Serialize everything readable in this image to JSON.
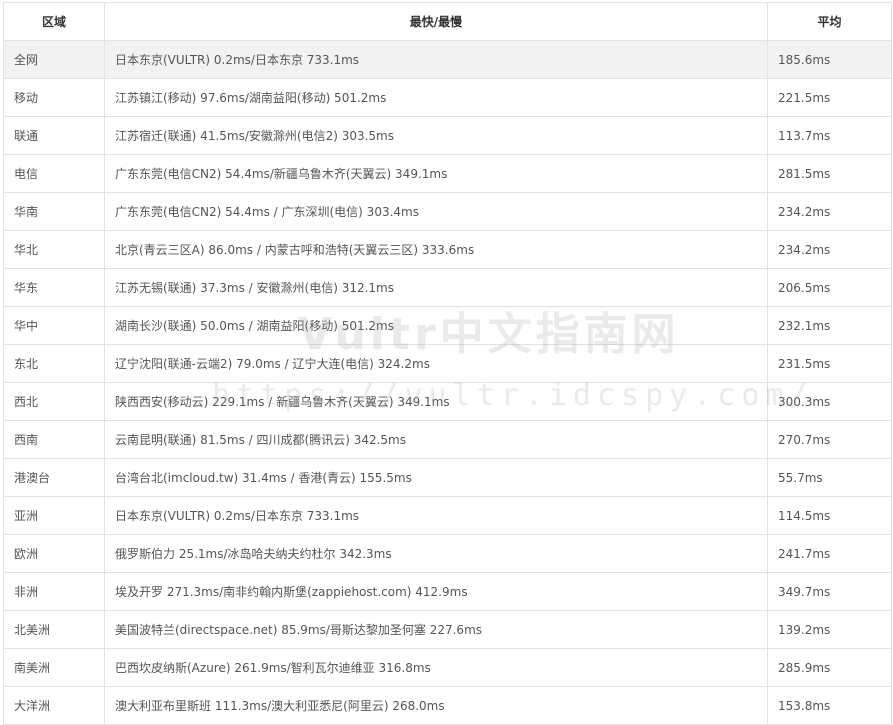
{
  "table": {
    "headers": {
      "region": "区域",
      "range": "最快/最慢",
      "average": "平均"
    },
    "rows": [
      {
        "region": "全网",
        "range": "日本东京(VULTR) 0.2ms/日本东京 733.1ms",
        "average": "185.6ms"
      },
      {
        "region": "移动",
        "range": "江苏镇江(移动) 97.6ms/湖南益阳(移动) 501.2ms",
        "average": "221.5ms"
      },
      {
        "region": "联通",
        "range": "江苏宿迁(联通) 41.5ms/安徽滁州(电信2) 303.5ms",
        "average": "113.7ms"
      },
      {
        "region": "电信",
        "range": "广东东莞(电信CN2) 54.4ms/新疆乌鲁木齐(天翼云) 349.1ms",
        "average": "281.5ms"
      },
      {
        "region": "华南",
        "range": "广东东莞(电信CN2) 54.4ms / 广东深圳(电信) 303.4ms",
        "average": "234.2ms"
      },
      {
        "region": "华北",
        "range": "北京(青云三区A) 86.0ms / 内蒙古呼和浩特(天翼云三区) 333.6ms",
        "average": "234.2ms"
      },
      {
        "region": "华东",
        "range": "江苏无锡(联通) 37.3ms / 安徽滁州(电信) 312.1ms",
        "average": "206.5ms"
      },
      {
        "region": "华中",
        "range": "湖南长沙(联通) 50.0ms / 湖南益阳(移动) 501.2ms",
        "average": "232.1ms"
      },
      {
        "region": "东北",
        "range": "辽宁沈阳(联通-云端2) 79.0ms / 辽宁大连(电信) 324.2ms",
        "average": "231.5ms"
      },
      {
        "region": "西北",
        "range": "陕西西安(移动云) 229.1ms / 新疆乌鲁木齐(天翼云) 349.1ms",
        "average": "300.3ms"
      },
      {
        "region": "西南",
        "range": "云南昆明(联通) 81.5ms / 四川成都(腾讯云) 342.5ms",
        "average": "270.7ms"
      },
      {
        "region": "港澳台",
        "range": "台湾台北(imcloud.tw) 31.4ms / 香港(青云) 155.5ms",
        "average": "55.7ms"
      },
      {
        "region": "亚洲",
        "range": "日本东京(VULTR) 0.2ms/日本东京 733.1ms",
        "average": "114.5ms"
      },
      {
        "region": "欧洲",
        "range": "俄罗斯伯力 25.1ms/冰岛哈夫纳夫约杜尔 342.3ms",
        "average": "241.7ms"
      },
      {
        "region": "非洲",
        "range": "埃及开罗 271.3ms/南非约翰内斯堡(zappiehost.com) 412.9ms",
        "average": "349.7ms"
      },
      {
        "region": "北美洲",
        "range": "美国波特兰(directspace.net) 85.9ms/哥斯达黎加圣何塞 227.6ms",
        "average": "139.2ms"
      },
      {
        "region": "南美洲",
        "range": "巴西坎皮纳斯(Azure) 261.9ms/智利瓦尔迪维亚 316.8ms",
        "average": "285.9ms"
      },
      {
        "region": "大洋洲",
        "range": "澳大利亚布里斯班 111.3ms/澳大利亚悉尼(阿里云) 268.0ms",
        "average": "153.8ms"
      }
    ]
  },
  "watermark": {
    "title": "Vultr中文指南网",
    "url": "https://vultr.idcspy.com/"
  }
}
